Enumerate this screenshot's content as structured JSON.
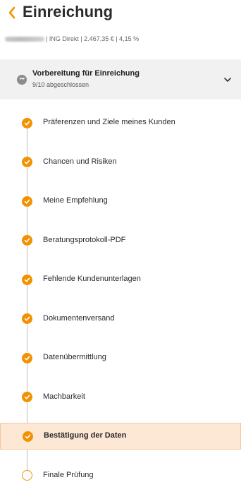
{
  "header": {
    "title": "Einreichung"
  },
  "subline": {
    "text": "| ING Direkt | 2.467,35 € | 4,15 %"
  },
  "group": {
    "title": "Vorbereitung für Einreichung",
    "status": "9/10 abgeschlossen"
  },
  "steps": [
    {
      "label": "Präferenzen und Ziele meines Kunden",
      "done": true
    },
    {
      "label": "Chancen und Risiken",
      "done": true
    },
    {
      "label": "Meine Empfehlung",
      "done": true
    },
    {
      "label": "Beratungsprotokoll-PDF",
      "done": true
    },
    {
      "label": "Fehlende Kundenunterlagen",
      "done": true
    },
    {
      "label": "Dokumentenversand",
      "done": true
    },
    {
      "label": "Datenübermittlung",
      "done": true
    },
    {
      "label": "Machbarkeit",
      "done": true
    },
    {
      "label": "Bestätigung der Daten",
      "done": true,
      "active": true
    },
    {
      "label": "Finale Prüfung",
      "done": false
    }
  ],
  "colors": {
    "accent": "#f39200",
    "active_bg": "#fde7d5",
    "group_bg": "#f1f1f1"
  }
}
